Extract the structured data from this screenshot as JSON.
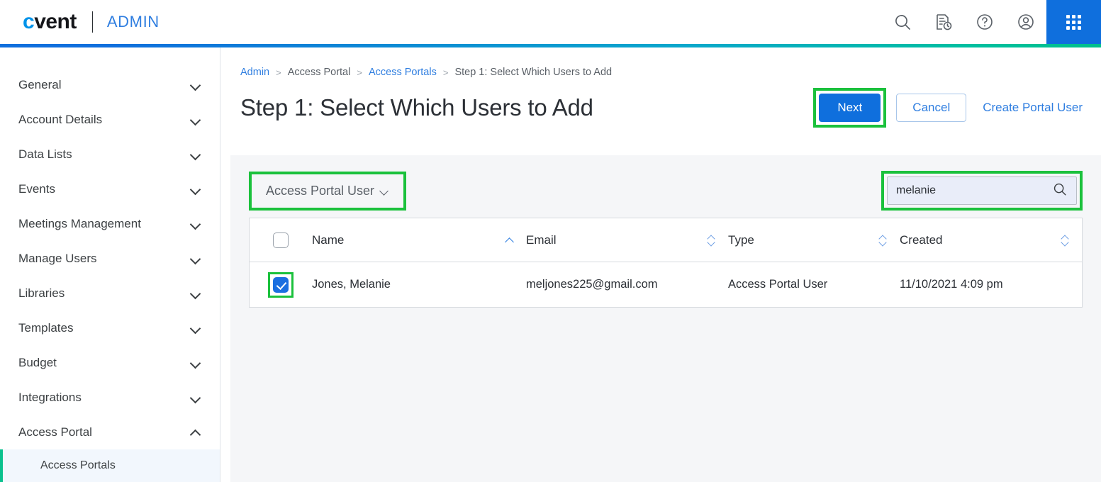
{
  "header": {
    "logo_text": "cvent",
    "logo_first_letter": "c",
    "logo_rest": "vent",
    "product": "ADMIN",
    "icons": [
      {
        "name": "search-icon",
        "label": "Search"
      },
      {
        "name": "recent-activity-icon",
        "label": "Recent"
      },
      {
        "name": "help-icon",
        "label": "Help"
      },
      {
        "name": "account-icon",
        "label": "Account"
      },
      {
        "name": "app-switcher-icon",
        "label": "Apps"
      }
    ],
    "accent_colors": {
      "start": "#0f6fdd",
      "end": "#00c08b"
    }
  },
  "sidebar": {
    "items": [
      {
        "label": "General",
        "expanded": false
      },
      {
        "label": "Account Details",
        "expanded": false
      },
      {
        "label": "Data Lists",
        "expanded": false
      },
      {
        "label": "Events",
        "expanded": false
      },
      {
        "label": "Meetings Management",
        "expanded": false
      },
      {
        "label": "Manage Users",
        "expanded": false
      },
      {
        "label": "Libraries",
        "expanded": false
      },
      {
        "label": "Templates",
        "expanded": false
      },
      {
        "label": "Budget",
        "expanded": false
      },
      {
        "label": "Integrations",
        "expanded": false
      },
      {
        "label": "Access Portal",
        "expanded": true
      }
    ],
    "sub_items": [
      {
        "label": "Access Portals",
        "active": true
      }
    ],
    "active_accent": "#0ac18e"
  },
  "breadcrumb": {
    "items": [
      {
        "label": "Admin",
        "link": true
      },
      {
        "label": "Access Portal",
        "link": false
      },
      {
        "label": "Access Portals",
        "link": true
      },
      {
        "label": "Step 1: Select Which Users to Add",
        "link": false
      }
    ],
    "separator": ">"
  },
  "page": {
    "title": "Step 1: Select Which Users to Add",
    "next_label": "Next",
    "cancel_label": "Cancel",
    "create_portal_user_label": "Create Portal User",
    "primary_color": "#0f6fdd",
    "highlight_color": "#1bc13c"
  },
  "toolbar": {
    "filter_label": "Access Portal User",
    "search_value": "melanie",
    "search_placeholder": "Search"
  },
  "table": {
    "columns": [
      {
        "label": "Name",
        "sort": "asc"
      },
      {
        "label": "Email",
        "sort": "none"
      },
      {
        "label": "Type",
        "sort": "none"
      },
      {
        "label": "Created",
        "sort": "none"
      }
    ],
    "header_checkbox_checked": false,
    "rows": [
      {
        "checked": true,
        "name": "Jones, Melanie",
        "email": "meljones225@gmail.com",
        "type": "Access Portal User",
        "created": "11/10/2021 4:09 pm"
      }
    ]
  }
}
